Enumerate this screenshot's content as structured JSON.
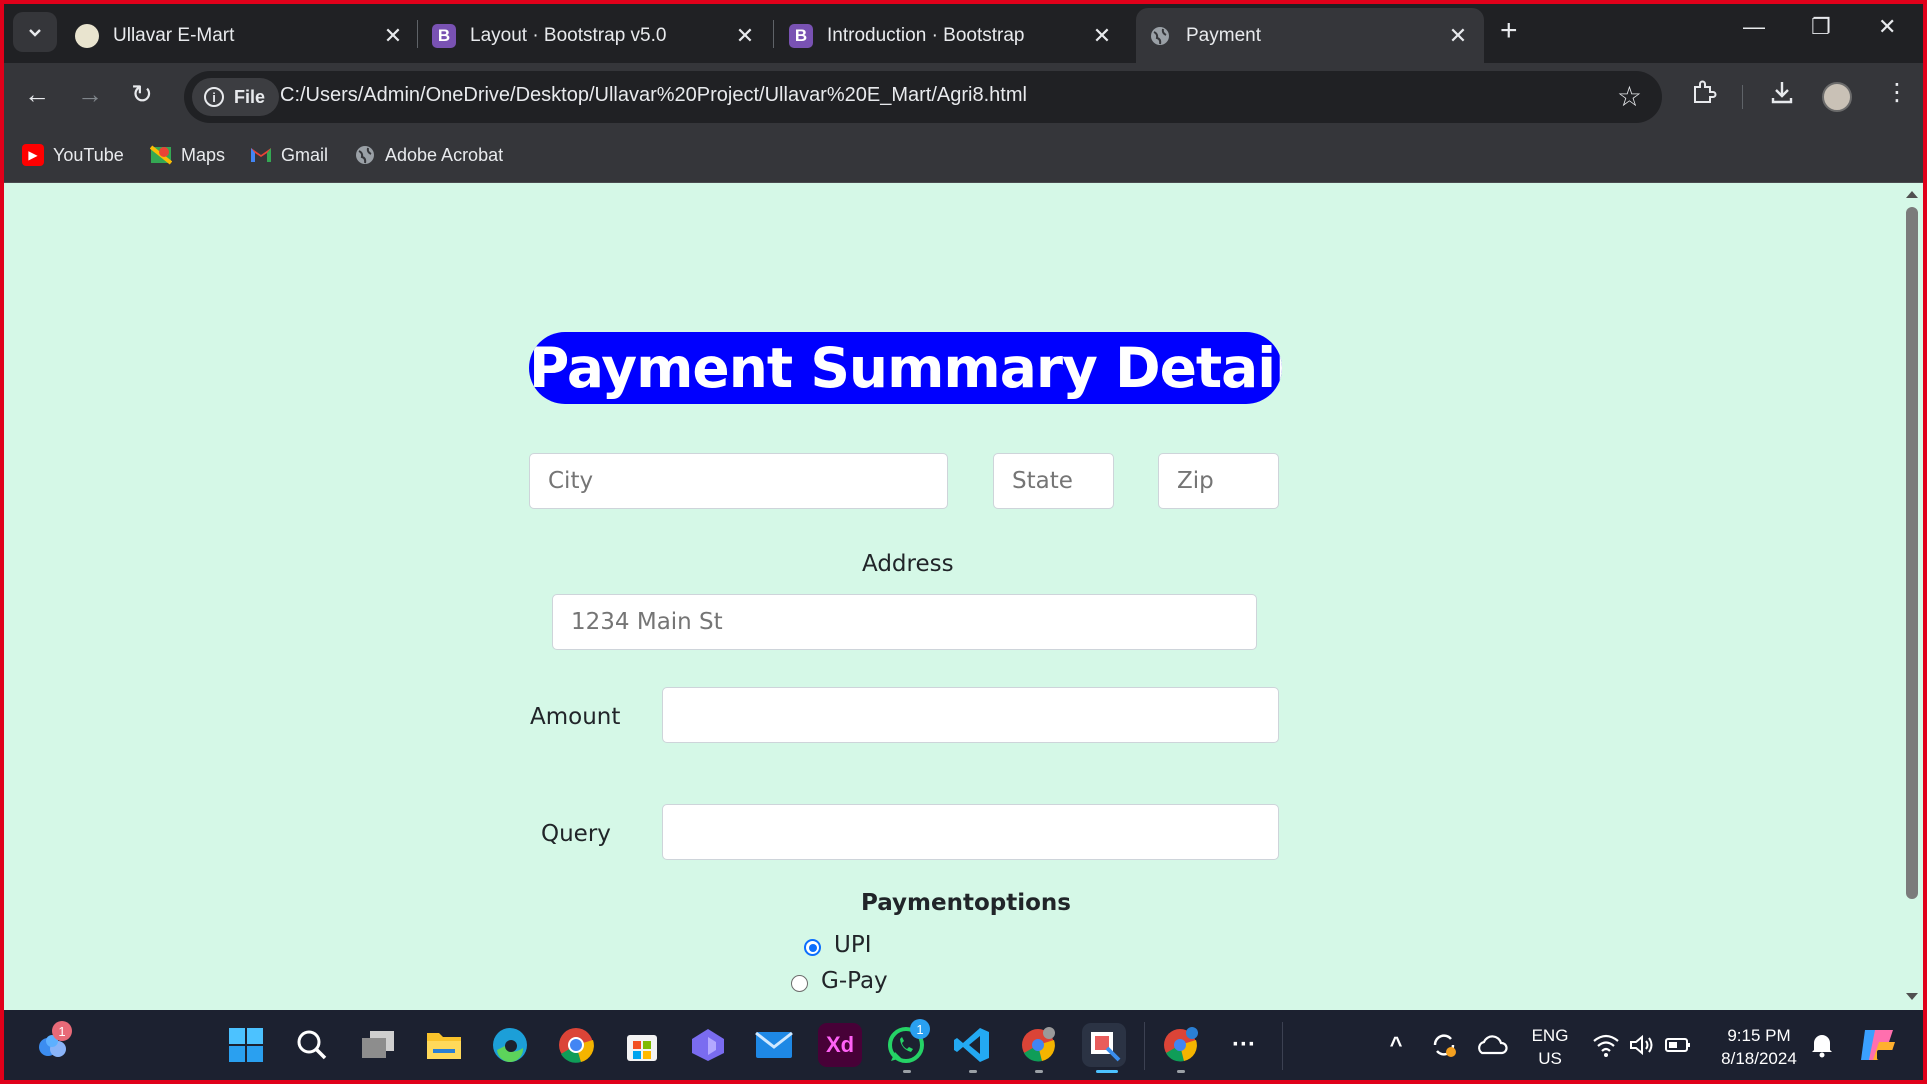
{
  "browser": {
    "tabs": [
      {
        "title": "Ullavar E-Mart",
        "favicon": "ullavar-logo-icon",
        "active": false
      },
      {
        "title": "Layout · Bootstrap v5.0",
        "favicon": "bootstrap-icon",
        "favicon_letter": "B",
        "active": false
      },
      {
        "title": "Introduction · Bootstrap",
        "favicon": "bootstrap-icon",
        "favicon_letter": "B",
        "active": false
      },
      {
        "title": "Payment",
        "favicon": "globe-icon",
        "active": true
      }
    ],
    "omnibox": {
      "chip_label": "File",
      "url": "C:/Users/Admin/OneDrive/Desktop/Ullavar%20Project/Ullavar%20E_Mart/Agri8.html"
    },
    "bookmarks": [
      {
        "label": "YouTube",
        "icon": "youtube-icon",
        "color": "#ff0000"
      },
      {
        "label": "Maps",
        "icon": "maps-icon",
        "color": "#34a853"
      },
      {
        "label": "Gmail",
        "icon": "gmail-icon",
        "color": "#ea4335"
      },
      {
        "label": "Adobe Acrobat",
        "icon": "globe-icon",
        "color": "#9aa0a6"
      }
    ]
  },
  "page": {
    "heading": "Payment Summary Details.!",
    "heading_bg": "#0000ff",
    "background": "#d5f8e7",
    "city_placeholder": "City",
    "state_placeholder": "State",
    "zip_placeholder": "Zip",
    "address_label": "Address",
    "address_placeholder": "1234 Main St",
    "amount_label": "Amount",
    "amount_value": "",
    "query_label": "Query",
    "query_value": "",
    "payment_options_label": "Paymentoptions",
    "payment_options": [
      {
        "label": "UPI",
        "checked": true
      },
      {
        "label": "G-Pay",
        "checked": false
      }
    ]
  },
  "taskbar": {
    "apps": [
      {
        "name": "copilot-widget-icon",
        "badge": "1"
      },
      {
        "name": "windows-start-icon"
      },
      {
        "name": "search-icon"
      },
      {
        "name": "task-view-icon"
      },
      {
        "name": "file-explorer-icon"
      },
      {
        "name": "edge-icon"
      },
      {
        "name": "chrome-icon"
      },
      {
        "name": "microsoft-store-icon"
      },
      {
        "name": "copilot-icon"
      },
      {
        "name": "mail-icon"
      },
      {
        "name": "adobe-xd-icon",
        "label": "Xd"
      },
      {
        "name": "whatsapp-icon",
        "badge": "1"
      },
      {
        "name": "vscode-icon"
      },
      {
        "name": "chrome-profile-icon"
      },
      {
        "name": "snipping-tool-icon"
      },
      {
        "name": "chrome-icon"
      },
      {
        "name": "more-apps-icon"
      }
    ],
    "tray": {
      "language_line1": "ENG",
      "language_line2": "US",
      "time": "9:15 PM",
      "date": "8/18/2024"
    }
  }
}
